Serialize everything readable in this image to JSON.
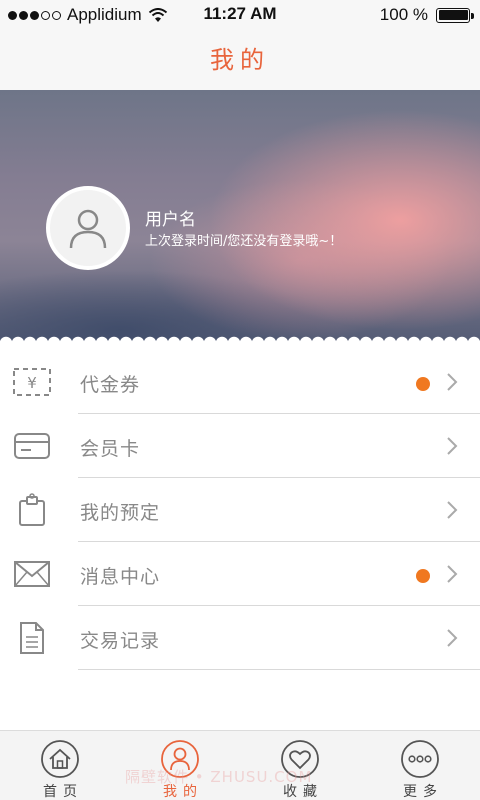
{
  "status_bar": {
    "carrier": "Applidium",
    "time": "11:27 AM",
    "battery": "100 %",
    "battery_level": 1.0
  },
  "nav": {
    "title": "我的"
  },
  "profile": {
    "username": "用户名",
    "last_login": "上次登录时间/您还没有登录哦~！"
  },
  "menu": {
    "items": [
      {
        "label": "代金券",
        "icon": "voucher-icon",
        "has_badge": true
      },
      {
        "label": "会员卡",
        "icon": "card-icon",
        "has_badge": false
      },
      {
        "label": "我的预定",
        "icon": "clipboard-icon",
        "has_badge": false
      },
      {
        "label": "消息中心",
        "icon": "mail-icon",
        "has_badge": true
      },
      {
        "label": "交易记录",
        "icon": "document-icon",
        "has_badge": false
      }
    ]
  },
  "tabs": {
    "items": [
      {
        "label": "首页",
        "icon": "home-icon",
        "active": false
      },
      {
        "label": "我的",
        "icon": "user-icon",
        "active": true
      },
      {
        "label": "收藏",
        "icon": "heart-icon",
        "active": false
      },
      {
        "label": "更多",
        "icon": "more-icon",
        "active": false
      }
    ]
  },
  "watermark": "隔壁软件 • ZHUSU.COM",
  "colors": {
    "accent": "#e8643c",
    "badge": "#f07820",
    "text_muted": "#888888"
  }
}
